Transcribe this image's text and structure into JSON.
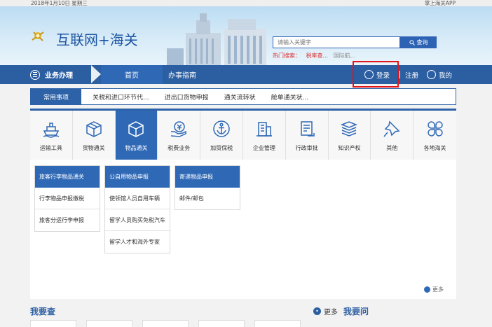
{
  "topbar": {
    "date": "2018年1月10日  星期三",
    "app": "掌上海关APP"
  },
  "header": {
    "title": "互联网+海关",
    "search_placeholder": "请输入关键字",
    "search_button": "查询",
    "hot_label": "热门搜索：",
    "hot_tags": [
      "税率查...",
      "国际航..."
    ]
  },
  "nav": {
    "menu": "业务办理",
    "home": "首页",
    "guide": "办事指南",
    "login": "登录",
    "register": "注册",
    "mine": "我的"
  },
  "common": {
    "label": "常用事项",
    "links": [
      "关税和进口环节代...",
      "进出口货物申报",
      "通关流转状",
      "舱单通关状..."
    ]
  },
  "tiles": [
    {
      "label": "运输工具",
      "icon": "ship-icon"
    },
    {
      "label": "货物通关",
      "icon": "box-icon"
    },
    {
      "label": "物品通关",
      "icon": "cube-icon",
      "active": true
    },
    {
      "label": "税费业务",
      "icon": "yuan-icon"
    },
    {
      "label": "加贸保税",
      "icon": "anchor-icon"
    },
    {
      "label": "企业管理",
      "icon": "building-icon"
    },
    {
      "label": "行政审批",
      "icon": "document-icon"
    },
    {
      "label": "知识产权",
      "icon": "books-icon"
    },
    {
      "label": "其他",
      "icon": "pin-icon"
    },
    {
      "label": "各地海关",
      "icon": "clover-icon"
    }
  ],
  "submenus": [
    {
      "header": "旅客行李物品通关",
      "items": [
        "行李物品申报缴税",
        "旅客分运行李申报"
      ]
    },
    {
      "header": "公自用物品申报",
      "items": [
        "使领馆人员自用车辆",
        "留学人员购买免税汽车",
        "留学人才和海外专家"
      ]
    },
    {
      "header": "寄递物品申报",
      "items": [
        "邮件/邮包"
      ]
    }
  ],
  "more_label": "更多",
  "bottom": {
    "left_title": "我要查",
    "more": "更多",
    "right_title": "我要问"
  },
  "colors": {
    "primary": "#2c5fa2",
    "highlight_box": "#e3141a"
  }
}
